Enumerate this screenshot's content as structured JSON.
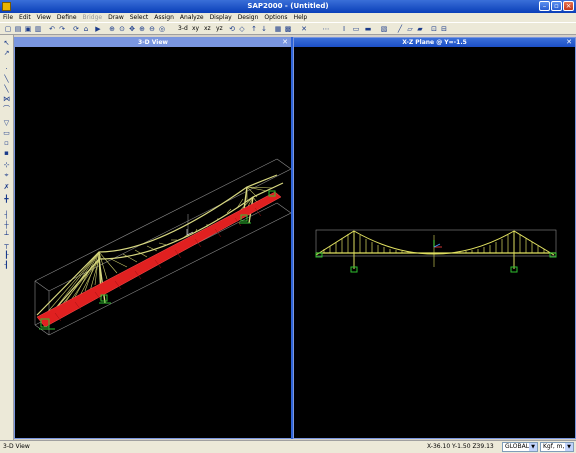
{
  "window": {
    "title": "SAP2000 - (Untitled)"
  },
  "menu": [
    {
      "label": "File",
      "enabled": true
    },
    {
      "label": "Edit",
      "enabled": true
    },
    {
      "label": "View",
      "enabled": true
    },
    {
      "label": "Define",
      "enabled": true
    },
    {
      "label": "Bridge",
      "enabled": false
    },
    {
      "label": "Draw",
      "enabled": true
    },
    {
      "label": "Select",
      "enabled": true
    },
    {
      "label": "Assign",
      "enabled": true
    },
    {
      "label": "Analyze",
      "enabled": true
    },
    {
      "label": "Display",
      "enabled": true
    },
    {
      "label": "Design",
      "enabled": true
    },
    {
      "label": "Options",
      "enabled": true
    },
    {
      "label": "Help",
      "enabled": true
    }
  ],
  "toolbar": {
    "view_3d": "3-d",
    "view_xy": "xy",
    "view_xz": "xz",
    "view_yz": "yz"
  },
  "panes": {
    "left": {
      "title": "3-D View"
    },
    "right": {
      "title": "X-Z Plane @ Y=-1.5"
    }
  },
  "status": {
    "left": "3-D View",
    "coords": "X-36.10  Y-1.50  Z39.13",
    "coord_system": "GLOBAL",
    "units": "Kgf, m, C"
  },
  "colors": {
    "accent": "#0a3fb8",
    "deck": "#e02020",
    "cable": "#e0e060",
    "support": "#30c030"
  }
}
